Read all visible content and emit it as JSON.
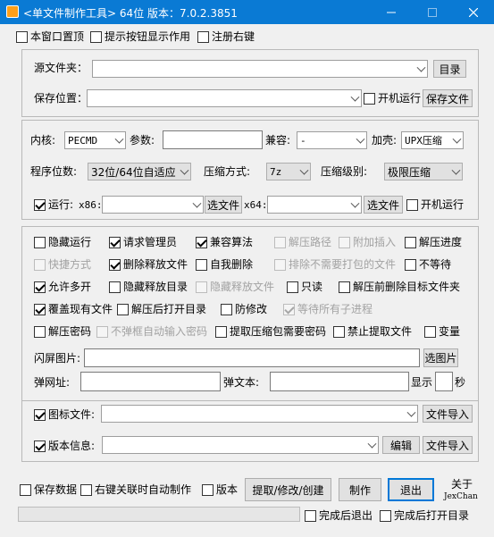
{
  "window": {
    "title": "<单文件制作工具> 64位 版本：7.0.2.3851"
  },
  "top_options": [
    {
      "label": "本窗口置顶",
      "checked": false
    },
    {
      "label": "提示按钮显示作用",
      "checked": false
    },
    {
      "label": "注册右键",
      "checked": false
    }
  ],
  "source": {
    "src_label": "源文件夹：",
    "src_value": "",
    "dir_button": "目录",
    "save_label": "保存位置：",
    "save_value": "",
    "startup_label": "开机运行",
    "save_file_button": "保存文件"
  },
  "kernel": {
    "kernel_label": "内核:",
    "kernel_value": "PECMD",
    "params_label": "参数:",
    "params_value": "",
    "compat_label": "兼容:",
    "compat_value": "-",
    "shell_label": "加壳:",
    "shell_value": "UPX压缩",
    "bits_label": "程序位数:",
    "bits_value": "32位/64位自适应",
    "method_label": "压缩方式:",
    "method_value": "7z",
    "level_label": "压缩级别:",
    "level_value": "极限压缩",
    "run_label": "运行:",
    "run_checked": true,
    "x86_label": "x86:",
    "x86_value": "",
    "x86_button": "选文件",
    "x64_label": "x64:",
    "x64_value": "",
    "x64_button": "选文件",
    "run_startup_label": "开机运行"
  },
  "options": [
    [
      {
        "label": "隐藏运行",
        "checked": false,
        "enabled": true
      },
      {
        "label": "请求管理员",
        "checked": true,
        "enabled": true
      },
      {
        "label": "兼容算法",
        "checked": true,
        "enabled": true
      },
      {
        "label": "解压路径",
        "checked": false,
        "enabled": false
      },
      {
        "label": "附加插入",
        "checked": false,
        "enabled": false
      },
      {
        "label": "解压进度",
        "checked": false,
        "enabled": true
      }
    ],
    [
      {
        "label": "快捷方式",
        "checked": false,
        "enabled": false
      },
      {
        "label": "删除释放文件",
        "checked": true,
        "enabled": true
      },
      {
        "label": "自我删除",
        "checked": false,
        "enabled": true
      },
      {
        "label": "排除不需要打包的文件",
        "checked": false,
        "enabled": false
      },
      {
        "label": "不等待",
        "checked": false,
        "enabled": true
      }
    ],
    [
      {
        "label": "允许多开",
        "checked": true,
        "enabled": true
      },
      {
        "label": "隐藏释放目录",
        "checked": false,
        "enabled": true
      },
      {
        "label": "隐藏释放文件",
        "checked": false,
        "enabled": false
      },
      {
        "label": "只读",
        "checked": false,
        "enabled": true
      },
      {
        "label": "解压前删除目标文件夹",
        "checked": false,
        "enabled": true
      }
    ],
    [
      {
        "label": "覆盖现有文件",
        "checked": true,
        "enabled": true
      },
      {
        "label": "解压后打开目录",
        "checked": false,
        "enabled": true
      },
      {
        "label": "防修改",
        "checked": false,
        "enabled": true
      },
      {
        "label": "等待所有子进程",
        "checked": true,
        "enabled": false
      }
    ],
    [
      {
        "label": "解压密码",
        "checked": false,
        "enabled": true
      },
      {
        "label": "不弹框自动输入密码",
        "checked": false,
        "enabled": false
      },
      {
        "label": "提取压缩包需要密码",
        "checked": false,
        "enabled": true
      },
      {
        "label": "禁止提取文件",
        "checked": false,
        "enabled": true
      },
      {
        "label": "变量",
        "checked": false,
        "enabled": true
      }
    ]
  ],
  "splash": {
    "image_label": "闪屏图片:",
    "image_value": "",
    "image_button": "选图片",
    "url_label": "弹网址:",
    "url_value": "",
    "text_label": "弹文本:",
    "text_value": "",
    "show_label": "显示",
    "seconds_value": "",
    "seconds_label": "秒"
  },
  "resources": {
    "icon_label": "图标文件:",
    "icon_checked": true,
    "icon_value": "",
    "icon_import": "文件导入",
    "version_label": "版本信息:",
    "version_checked": true,
    "version_value": "",
    "edit_button": "编辑",
    "version_import": "文件导入"
  },
  "bottom": {
    "save_data": "保存数据",
    "right_click_auto": "右键关联时自动制作",
    "version_cb": "版本",
    "extract_button": "提取/修改/创建",
    "make_button": "制作",
    "exit_button": "退出",
    "about_label": "关于",
    "author_label": "JexChan",
    "exit_after": "完成后退出",
    "open_after": "完成后打开目录",
    "progress": 0
  }
}
